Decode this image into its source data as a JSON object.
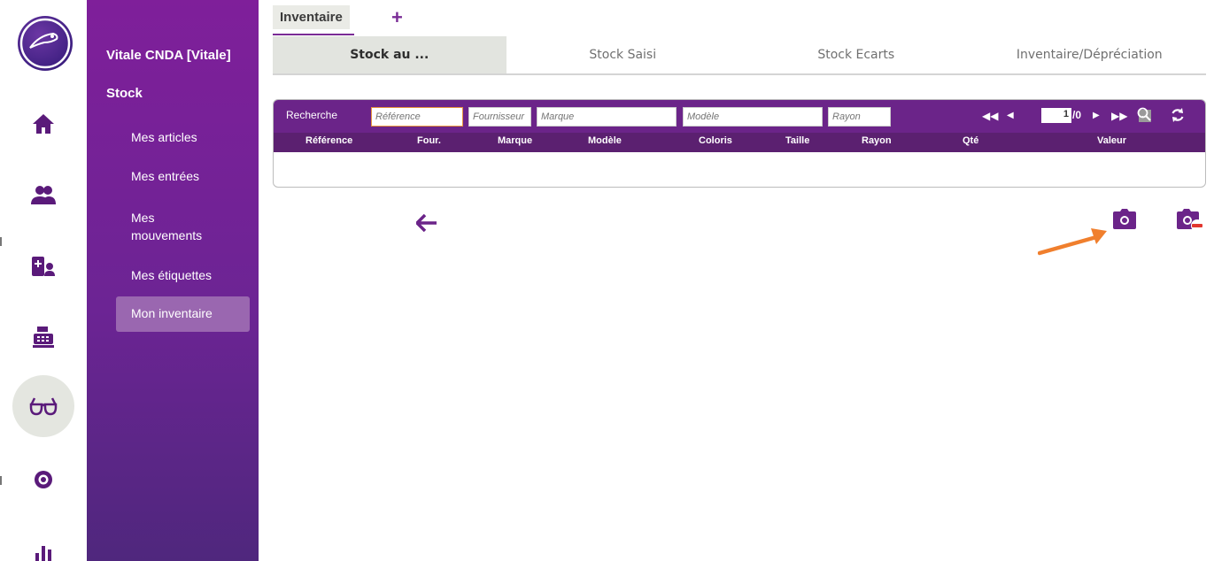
{
  "nav_rail": {
    "icons": [
      "logo-icon",
      "home-icon",
      "users-icon",
      "patient-card-icon",
      "cash-register-icon",
      "glasses-icon",
      "eye-icon",
      "bar-chart-icon"
    ],
    "active": "glasses-icon"
  },
  "sidebar": {
    "company": "Vitale CNDA [Vitale]",
    "section": "Stock",
    "items": [
      {
        "label": "Mes articles"
      },
      {
        "label": "Mes entrées"
      },
      {
        "label": "Mes\nmouvements"
      },
      {
        "label": "Mes étiquettes"
      },
      {
        "label": "Mon inventaire"
      }
    ],
    "active_item": "Mon inventaire"
  },
  "tabs": {
    "main": "Inventaire",
    "add": "+"
  },
  "subtabs": [
    {
      "label": "Stock au ..."
    },
    {
      "label": "Stock Saisi"
    },
    {
      "label": "Stock Ecarts"
    },
    {
      "label": "Inventaire/Dépréciation"
    }
  ],
  "search": {
    "label": "Recherche",
    "fields": {
      "reference": {
        "placeholder": "Référence",
        "value": ""
      },
      "fournisseur": {
        "placeholder": "Fournisseur",
        "value": ""
      },
      "marque": {
        "placeholder": "Marque",
        "value": ""
      },
      "modele": {
        "placeholder": "Modèle",
        "value": ""
      },
      "rayon": {
        "placeholder": "Rayon",
        "value": ""
      }
    },
    "ellipsis": "..."
  },
  "pager": {
    "first": "◀◀",
    "prev": "◀",
    "page": "1",
    "total": "/0",
    "next": "▶",
    "last": "▶▶"
  },
  "grid": {
    "columns": [
      "Référence",
      "Four.",
      "Marque",
      "Modèle",
      "Coloris",
      "Taille",
      "Rayon",
      "Qté",
      "Valeur"
    ],
    "rows": []
  },
  "colors": {
    "sidebar_top": "#7f1f9a",
    "sidebar_bottom": "#4f277d",
    "accent": "#7a2c96",
    "search_bar": "#6b2489",
    "header_row": "#5b2070",
    "annotation": "#f07f2d"
  }
}
